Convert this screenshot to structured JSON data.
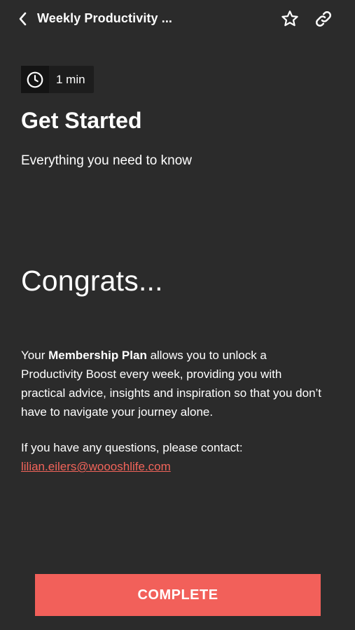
{
  "header": {
    "title": "Weekly Productivity ...",
    "back_icon": "chevron-left-icon",
    "favorite_icon": "star-outline-icon",
    "share_icon": "link-icon"
  },
  "lesson": {
    "duration_icon": "clock-icon",
    "duration": "1 min",
    "title": "Get Started",
    "subtitle": "Everything you need to know"
  },
  "content": {
    "heading": "Congrats...",
    "paragraph_prefix": "Your ",
    "paragraph_bold": "Membership Plan",
    "paragraph_suffix": " allows you to unlock a Productivity Boost every week, providing you with practical advice, insights and inspiration so that you don’t have to navigate your journey alone.",
    "contact_prompt": "If you have any questions, please contact:",
    "contact_email": "lilian.eilers@woooshlife.com"
  },
  "actions": {
    "complete_label": "COMPLETE"
  },
  "colors": {
    "background": "#2b2b2b",
    "accent": "#f2605a",
    "text": "#ffffff"
  }
}
